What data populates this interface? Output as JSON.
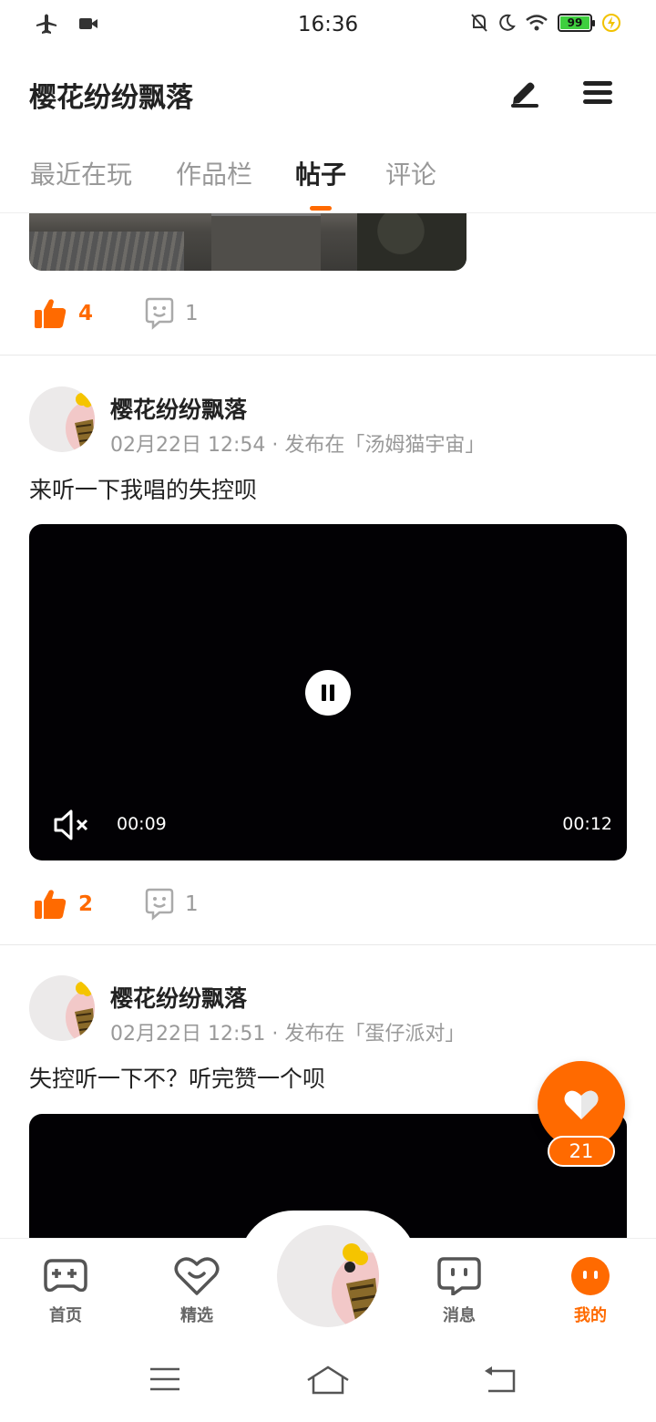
{
  "status_bar": {
    "time": "16:36",
    "battery_level": "99"
  },
  "header": {
    "title": "樱花纷纷飘落",
    "edit_icon": "pen-icon",
    "menu_icon": "hamburger-menu-icon"
  },
  "tabs": [
    {
      "label": "最近在玩",
      "active": false
    },
    {
      "label": "作品栏",
      "active": false
    },
    {
      "label": "帖子",
      "active": true
    },
    {
      "label": "评论",
      "active": false
    }
  ],
  "posts": [
    {
      "likes": "4",
      "comments": "1"
    },
    {
      "author": "樱花纷纷飘落",
      "meta": "02月22日 12:54 · 发布在「汤姆猫宇宙」",
      "text": "来听一下我唱的失控呗",
      "video": {
        "current_time": "00:09",
        "duration": "00:12"
      },
      "likes": "2",
      "comments": "1"
    },
    {
      "author": "樱花纷纷飘落",
      "meta": "02月22日 12:51 · 发布在「蛋仔派对」",
      "text": "失控听一下不？听完赞一个呗"
    }
  ],
  "floating_like": {
    "count": "21"
  },
  "bottom_nav": [
    {
      "label": "首页",
      "icon": "gamepad-icon"
    },
    {
      "label": "精选",
      "icon": "heart-outline-icon"
    },
    {
      "label": "消息",
      "icon": "chat-icon"
    },
    {
      "label": "我的",
      "icon": "profile-face-icon",
      "active": true
    }
  ],
  "colors": {
    "accent": "#ff6a00"
  }
}
